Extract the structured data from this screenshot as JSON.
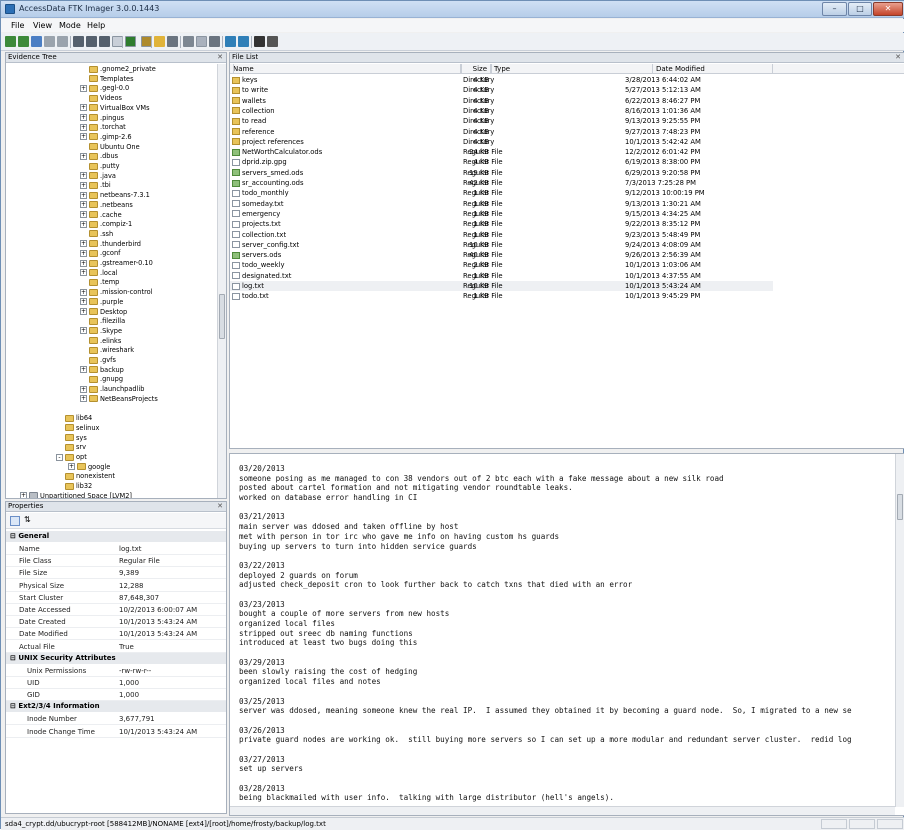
{
  "window": {
    "title": "AccessData FTK Imager 3.0.0.1443"
  },
  "menu": [
    "File",
    "View",
    "Mode",
    "Help"
  ],
  "toolbar": {
    "icons": [
      "add-evidence-icon",
      "add-all-icon",
      "image-mount-icon",
      "remove-evidence-icon",
      "remove-all-icon",
      "create-image-icon",
      "export-disk-image-icon",
      "export-logical-image-icon",
      "add-to-custom-icon",
      "verify-drive-icon",
      "capture-memory-icon",
      "obtain-protected-files-icon",
      "detect-efs-icon",
      "export-files-icon",
      "export-file-hash-icon",
      "export-directory-listing-icon",
      "mount-image-icon",
      "image-mounting-icon",
      "help-icon",
      "about-icon"
    ]
  },
  "evidence_tree": {
    "title": "Evidence Tree",
    "rows": [
      {
        "label": ".gnome2_private",
        "indent": 6,
        "exp": ""
      },
      {
        "label": "Templates",
        "indent": 6,
        "exp": ""
      },
      {
        "label": ".gegl-0.0",
        "indent": 6,
        "exp": "+"
      },
      {
        "label": "Videos",
        "indent": 6,
        "exp": ""
      },
      {
        "label": "VirtualBox VMs",
        "indent": 6,
        "exp": "+"
      },
      {
        "label": ".pingus",
        "indent": 6,
        "exp": "+"
      },
      {
        "label": ".torchat",
        "indent": 6,
        "exp": "+"
      },
      {
        "label": ".gimp-2.6",
        "indent": 6,
        "exp": "+"
      },
      {
        "label": "Ubuntu One",
        "indent": 6,
        "exp": ""
      },
      {
        "label": ".dbus",
        "indent": 6,
        "exp": "+"
      },
      {
        "label": ".putty",
        "indent": 6,
        "exp": ""
      },
      {
        "label": ".java",
        "indent": 6,
        "exp": "+"
      },
      {
        "label": ".tbi",
        "indent": 6,
        "exp": "+"
      },
      {
        "label": "netbeans-7.3.1",
        "indent": 6,
        "exp": "+"
      },
      {
        "label": ".netbeans",
        "indent": 6,
        "exp": "+"
      },
      {
        "label": ".cache",
        "indent": 6,
        "exp": "+"
      },
      {
        "label": ".compiz-1",
        "indent": 6,
        "exp": "+"
      },
      {
        "label": ".ssh",
        "indent": 6,
        "exp": ""
      },
      {
        "label": ".thunderbird",
        "indent": 6,
        "exp": "+"
      },
      {
        "label": ".gconf",
        "indent": 6,
        "exp": "+"
      },
      {
        "label": ".gstreamer-0.10",
        "indent": 6,
        "exp": "+"
      },
      {
        "label": ".local",
        "indent": 6,
        "exp": "+"
      },
      {
        "label": ".temp",
        "indent": 6,
        "exp": ""
      },
      {
        "label": ".mission-control",
        "indent": 6,
        "exp": "+"
      },
      {
        "label": ".purple",
        "indent": 6,
        "exp": "+"
      },
      {
        "label": "Desktop",
        "indent": 6,
        "exp": "+"
      },
      {
        "label": ".filezilla",
        "indent": 6,
        "exp": ""
      },
      {
        "label": ".Skype",
        "indent": 6,
        "exp": "+"
      },
      {
        "label": ".elinks",
        "indent": 6,
        "exp": ""
      },
      {
        "label": ".wireshark",
        "indent": 6,
        "exp": ""
      },
      {
        "label": ".gvfs",
        "indent": 6,
        "exp": ""
      },
      {
        "label": "backup",
        "indent": 6,
        "exp": "+"
      },
      {
        "label": ".gnupg",
        "indent": 6,
        "exp": ""
      },
      {
        "label": ".launchpadlib",
        "indent": 6,
        "exp": "+"
      },
      {
        "label": "NetBeansProjects",
        "indent": 6,
        "exp": "+"
      },
      {
        "label": "",
        "indent": 6,
        "exp": ""
      },
      {
        "label": "lib64",
        "indent": 4,
        "exp": ""
      },
      {
        "label": "selinux",
        "indent": 4,
        "exp": ""
      },
      {
        "label": "sys",
        "indent": 4,
        "exp": ""
      },
      {
        "label": "srv",
        "indent": 4,
        "exp": ""
      },
      {
        "label": "opt",
        "indent": 4,
        "exp": "-"
      },
      {
        "label": "google",
        "indent": 5,
        "exp": "+"
      },
      {
        "label": "nonexistent",
        "indent": 4,
        "exp": ""
      },
      {
        "label": "lib32",
        "indent": 4,
        "exp": ""
      },
      {
        "label": "Unpartitioned Space [LVM2]",
        "indent": 1,
        "exp": "+"
      }
    ]
  },
  "properties": {
    "title": "Properties",
    "sections": [
      {
        "title": "General",
        "rows": [
          {
            "label": "Name",
            "value": "log.txt"
          },
          {
            "label": "File Class",
            "value": "Regular File"
          },
          {
            "label": "File Size",
            "value": "9,389"
          },
          {
            "label": "Physical Size",
            "value": "12,288"
          },
          {
            "label": "Start Cluster",
            "value": "87,648,307"
          },
          {
            "label": "Date Accessed",
            "value": "10/2/2013 6:00:07 AM"
          },
          {
            "label": "Date Created",
            "value": "10/1/2013 5:43:24 AM"
          },
          {
            "label": "Date Modified",
            "value": "10/1/2013 5:43:24 AM"
          },
          {
            "label": "Actual File",
            "value": "True"
          }
        ]
      },
      {
        "title": "UNIX Security Attributes",
        "rows": [
          {
            "label": "Unix Permissions",
            "value": "-rw-rw-r--"
          },
          {
            "label": "UID",
            "value": "1,000"
          },
          {
            "label": "GID",
            "value": "1,000"
          }
        ]
      },
      {
        "title": "Ext2/3/4 Information",
        "rows": [
          {
            "label": "Inode Number",
            "value": "3,677,791"
          },
          {
            "label": "Inode Change Time",
            "value": "10/1/2013 5:43:24 AM"
          }
        ]
      }
    ]
  },
  "file_list": {
    "title": "File List",
    "columns": [
      "Name",
      "Size",
      "Type",
      "Date Modified"
    ],
    "rows": [
      {
        "name": "keys",
        "size": "4 KB",
        "type": "Directory",
        "date": "3/28/2013 6:44:02 AM",
        "kind": "dir"
      },
      {
        "name": "to write",
        "size": "4 KB",
        "type": "Directory",
        "date": "5/27/2013 5:12:13 AM",
        "kind": "dir"
      },
      {
        "name": "wallets",
        "size": "4 KB",
        "type": "Directory",
        "date": "6/22/2013 8:46:27 PM",
        "kind": "dir"
      },
      {
        "name": "collection",
        "size": "4 KB",
        "type": "Directory",
        "date": "8/16/2013 1:01:36 AM",
        "kind": "dir"
      },
      {
        "name": "to read",
        "size": "4 KB",
        "type": "Directory",
        "date": "9/13/2013 9:25:55 PM",
        "kind": "dir"
      },
      {
        "name": "reference",
        "size": "4 KB",
        "type": "Directory",
        "date": "9/27/2013 7:48:23 PM",
        "kind": "dir"
      },
      {
        "name": "project references",
        "size": "4 KB",
        "type": "Directory",
        "date": "10/1/2013 5:42:42 AM",
        "kind": "dir"
      },
      {
        "name": "NetWorthCalculator.ods",
        "size": "24 KB",
        "type": "Regular File",
        "date": "12/2/2012 6:01:42 PM",
        "kind": "ods"
      },
      {
        "name": "dprid.zip.gpg",
        "size": "4 KB",
        "type": "Regular File",
        "date": "6/19/2013 8:38:00 PM",
        "kind": "file"
      },
      {
        "name": "servers_smed.ods",
        "size": "19 KB",
        "type": "Regular File",
        "date": "6/29/2013 9:20:58 PM",
        "kind": "ods"
      },
      {
        "name": "sr_accounting.ods",
        "size": "42 KB",
        "type": "Regular File",
        "date": "7/3/2013 7:25:28 PM",
        "kind": "ods"
      },
      {
        "name": "todo_monthly",
        "size": "1 KB",
        "type": "Regular File",
        "date": "9/12/2013 10:00:19 PM",
        "kind": "file"
      },
      {
        "name": "someday.txt",
        "size": "1 KB",
        "type": "Regular File",
        "date": "9/13/2013 1:30:21 AM",
        "kind": "file"
      },
      {
        "name": "emergency",
        "size": "1 KB",
        "type": "Regular File",
        "date": "9/15/2013 4:34:25 AM",
        "kind": "file"
      },
      {
        "name": "projects.txt",
        "size": "1 KB",
        "type": "Regular File",
        "date": "9/22/2013 8:35:12 PM",
        "kind": "file"
      },
      {
        "name": "collection.txt",
        "size": "1 KB",
        "type": "Regular File",
        "date": "9/23/2013 5:48:49 PM",
        "kind": "file"
      },
      {
        "name": "server_config.txt",
        "size": "10 KB",
        "type": "Regular File",
        "date": "9/24/2013 4:08:09 AM",
        "kind": "file"
      },
      {
        "name": "servers.ods",
        "size": "40 KB",
        "type": "Regular File",
        "date": "9/26/2013 2:56:39 AM",
        "kind": "ods"
      },
      {
        "name": "todo_weekly",
        "size": "2 KB",
        "type": "Regular File",
        "date": "10/1/2013 1:03:06 AM",
        "kind": "file"
      },
      {
        "name": "designated.txt",
        "size": "1 KB",
        "type": "Regular File",
        "date": "10/1/2013 4:37:55 AM",
        "kind": "file"
      },
      {
        "name": "log.txt",
        "size": "10 KB",
        "type": "Regular File",
        "date": "10/1/2013 5:43:24 AM",
        "kind": "file"
      },
      {
        "name": "todo.txt",
        "size": "1 KB",
        "type": "Regular File",
        "date": "10/1/2013 9:45:29 PM",
        "kind": "file"
      }
    ]
  },
  "viewer": {
    "lines": [
      "03/20/2013",
      "someone posing as me managed to con 38 vendors out of 2 btc each with a fake message about a new silk road",
      "posted about cartel formation and not mitigating vendor roundtable leaks.",
      "worked on database error handling in CI",
      "",
      "03/21/2013",
      "main server was ddosed and taken offline by host",
      "met with person in tor irc who gave me info on having custom hs guards",
      "buying up servers to turn into hidden service guards",
      "",
      "03/22/2013",
      "deployed 2 guards on forum",
      "adjusted check_deposit cron to look further back to catch txns that died with an error",
      "",
      "03/23/2013",
      "bought a couple of more servers from new hosts",
      "organized local files",
      "stripped out sreec db naming functions",
      "introduced at least two bugs doing this",
      "",
      "03/29/2013",
      "been slowly raising the cost of hedging",
      "organized local files and notes",
      "",
      "03/25/2013",
      "server was ddosed, meaning someone knew the real IP.  I assumed they obtained it by becoming a guard node.  So, I migrated to a new se",
      "",
      "03/26/2013",
      "private guard nodes are working ok.  still buying more servers so I can set up a more modular and redundant server cluster.  redid log",
      "",
      "03/27/2013",
      "set up servers",
      "",
      "03/28/2013",
      "being blackmailed with user info.  talking with large distributor (hell's angels)."
    ]
  },
  "status": {
    "path": "sda4_crypt.dd/ubucrypt-root [588412MB]/NONAME [ext4]/[root]/home/frosty/backup/log.txt"
  }
}
